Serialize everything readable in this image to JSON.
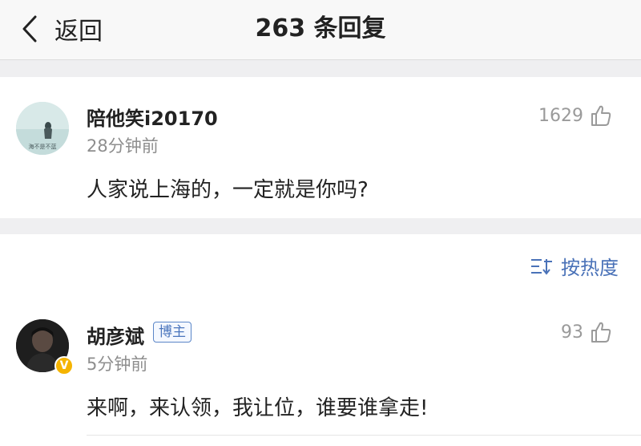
{
  "header": {
    "back_label": "返回",
    "title": "263 条回复"
  },
  "main_comment": {
    "avatar_text": "海不是不蓝",
    "username": "陪他笑i20170",
    "time": "28分钟前",
    "content": "人家说上海的，一定就是你吗?",
    "likes": "1629"
  },
  "sort": {
    "label": "按热度"
  },
  "replies": [
    {
      "username": "胡彦斌",
      "badge": "博主",
      "verified_badge": "V",
      "time": "5分钟前",
      "content": "来啊，来认领，我让位，谁要谁拿走!",
      "likes": "93"
    }
  ],
  "colors": {
    "link_blue": "#4a72b8",
    "verified_gold": "#f5b400",
    "muted_text": "#8e8e8e"
  }
}
